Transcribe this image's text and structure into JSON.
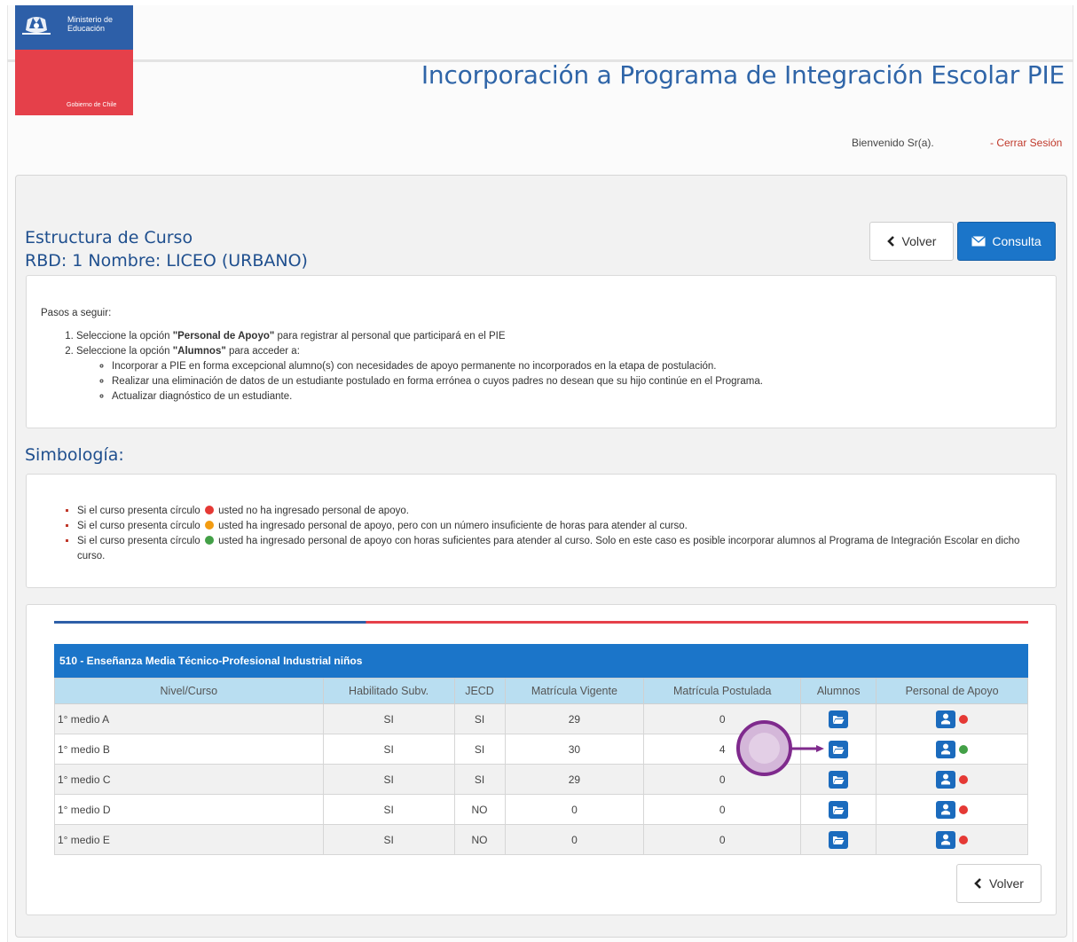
{
  "header": {
    "logo_ministry": "Ministerio de Educación",
    "logo_government": "Gobierno de Chile",
    "app_title": "Incorporación a Programa de Integración Escolar PIE",
    "welcome": "Bienvenido Sr(a).",
    "logout": "- Cerrar Sesión"
  },
  "page": {
    "title": "Estructura de Curso",
    "subtitle": "RBD: 1 Nombre: LICEO (URBANO)",
    "back_label": "Volver",
    "consult_label": "Consulta"
  },
  "steps": {
    "heading": "Pasos a seguir:",
    "step1_pre": "Seleccione la opción ",
    "step1_bold": "\"Personal de Apoyo\"",
    "step1_post": " para registrar al personal que participará en el PIE",
    "step2_pre": "Seleccione la opción ",
    "step2_bold": "\"Alumnos\"",
    "step2_post": " para acceder a:",
    "sub": [
      "Incorporar a PIE en forma excepcional alumno(s) con necesidades de apoyo permanente no incorporados en la etapa de postulación.",
      "Realizar una eliminación de datos de un estudiante postulado en forma errónea o cuyos padres no desean que su hijo continúe en el Programa.",
      "Actualizar diagnóstico de un estudiante."
    ]
  },
  "symbology": {
    "title": "Simbología:",
    "items": [
      {
        "pre": "Si el curso presenta círculo",
        "post": "usted no ha ingresado personal de apoyo.",
        "color": "#e53935"
      },
      {
        "pre": "Si el curso presenta círculo",
        "post": "usted ha ingresado personal de apoyo, pero con un número insuficiente de horas para atender al curso.",
        "color": "#f39c12"
      },
      {
        "pre": "Si el curso presenta círculo",
        "post": "usted ha ingresado personal de apoyo con horas suficientes para atender al curso. Solo en este caso es posible incorporar alumnos al Programa de Integración Escolar en dicho curso.",
        "color": "#43a047"
      }
    ]
  },
  "table": {
    "group_title": "510 - Enseñanza Media Técnico-Profesional Industrial niños",
    "columns": [
      "Nivel/Curso",
      "Habilitado Subv.",
      "JECD",
      "Matrícula Vigente",
      "Matrícula Postulada",
      "Alumnos",
      "Personal de Apoyo"
    ],
    "rows": [
      {
        "curso": "1° medio A",
        "habilitado": "SI",
        "jecd": "SI",
        "vigente": "29",
        "postulada": "0",
        "status": "red"
      },
      {
        "curso": "1° medio B",
        "habilitado": "SI",
        "jecd": "SI",
        "vigente": "30",
        "postulada": "4",
        "status": "green"
      },
      {
        "curso": "1° medio C",
        "habilitado": "SI",
        "jecd": "SI",
        "vigente": "29",
        "postulada": "0",
        "status": "red"
      },
      {
        "curso": "1° medio D",
        "habilitado": "SI",
        "jecd": "NO",
        "vigente": "0",
        "postulada": "0",
        "status": "red"
      },
      {
        "curso": "1° medio E",
        "habilitado": "SI",
        "jecd": "NO",
        "vigente": "0",
        "postulada": "0",
        "status": "red"
      }
    ],
    "bottom_back_label": "Volver"
  },
  "colors": {
    "brand_blue": "#2d5fa8",
    "brand_red": "#e5404a",
    "primary_button": "#1b75c9",
    "status_red": "#e53935",
    "status_green": "#43a047",
    "annotation": "#7f2a8d"
  },
  "icons": {
    "alumnos": "folder-open-icon",
    "personal": "user-icon",
    "back": "chevron-left-icon",
    "consult": "envelope-icon"
  }
}
